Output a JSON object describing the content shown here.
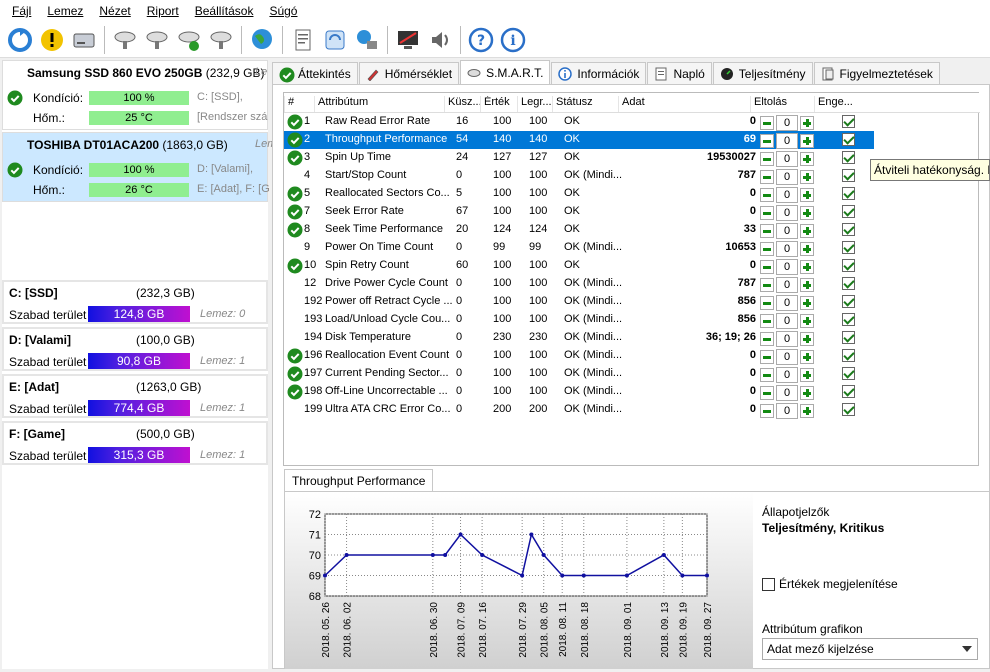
{
  "menu": [
    "Fájl",
    "Lemez",
    "Nézet",
    "Riport",
    "Beállítások",
    "Súgó"
  ],
  "drives": [
    {
      "name": "Samsung SSD 860 EVO 250GB",
      "size": "(232,9 GB)",
      "lemez": "Le",
      "cond_label": "Kondíció:",
      "cond": "100 %",
      "cond_aux": "C: [SSD],",
      "temp_label": "Hőm.:",
      "temp": "25 °C",
      "temp_aux": "[Rendszer szá"
    },
    {
      "name": "TOSHIBA DT01ACA200",
      "size": "(1863,0 GB)",
      "lemez": "Lemez: 1",
      "cond_label": "Kondíció:",
      "cond": "100 %",
      "cond_aux": "D: [Valami],",
      "temp_label": "Hőm.:",
      "temp": "26 °C",
      "temp_aux": "E: [Adat], F: [G"
    }
  ],
  "volumes": [
    {
      "name": "C: [SSD]",
      "size": "(232,3 GB)",
      "free_label": "Szabad terület",
      "free": "124,8 GB",
      "lemez": "Lemez: 0"
    },
    {
      "name": "D: [Valami]",
      "size": "(100,0 GB)",
      "free_label": "Szabad terület",
      "free": "90,8 GB",
      "lemez": "Lemez: 1"
    },
    {
      "name": "E: [Adat]",
      "size": "(1263,0 GB)",
      "free_label": "Szabad terület",
      "free": "774,4 GB",
      "lemez": "Lemez: 1"
    },
    {
      "name": "F: [Game]",
      "size": "(500,0 GB)",
      "free_label": "Szabad terület",
      "free": "315,3 GB",
      "lemez": "Lemez: 1"
    }
  ],
  "tabs": [
    "Áttekintés",
    "Hőmérséklet",
    "S.M.A.R.T.",
    "Információk",
    "Napló",
    "Teljesítmény",
    "Figyelmeztetések"
  ],
  "columns": [
    "#",
    "Attribútum",
    "Küsz...",
    "Érték",
    "Legr...",
    "Státusz",
    "Adat",
    "Eltolás",
    "Enge..."
  ],
  "rows": [
    {
      "id": "1",
      "attr": "Raw Read Error Rate",
      "thr": "16",
      "val": "100",
      "worst": "100",
      "status": "OK",
      "data": "0",
      "shift": "0",
      "ok": true
    },
    {
      "id": "2",
      "attr": "Throughput Performance",
      "thr": "54",
      "val": "140",
      "worst": "140",
      "status": "OK",
      "data": "69",
      "shift": "0",
      "ok": true,
      "sel": true
    },
    {
      "id": "3",
      "attr": "Spin Up Time",
      "thr": "24",
      "val": "127",
      "worst": "127",
      "status": "OK",
      "data": "19530027",
      "shift": "0",
      "ok": true
    },
    {
      "id": "4",
      "attr": "Start/Stop Count",
      "thr": "0",
      "val": "100",
      "worst": "100",
      "status": "OK (Mindi...",
      "data": "787",
      "shift": "0",
      "ok": false
    },
    {
      "id": "5",
      "attr": "Reallocated Sectors Co...",
      "thr": "5",
      "val": "100",
      "worst": "100",
      "status": "OK",
      "data": "0",
      "shift": "0",
      "ok": true
    },
    {
      "id": "7",
      "attr": "Seek Error Rate",
      "thr": "67",
      "val": "100",
      "worst": "100",
      "status": "OK",
      "data": "0",
      "shift": "0",
      "ok": true
    },
    {
      "id": "8",
      "attr": "Seek Time Performance",
      "thr": "20",
      "val": "124",
      "worst": "124",
      "status": "OK",
      "data": "33",
      "shift": "0",
      "ok": true
    },
    {
      "id": "9",
      "attr": "Power On Time Count",
      "thr": "0",
      "val": "99",
      "worst": "99",
      "status": "OK (Mindi...",
      "data": "10653",
      "shift": "0",
      "ok": false
    },
    {
      "id": "10",
      "attr": "Spin Retry Count",
      "thr": "60",
      "val": "100",
      "worst": "100",
      "status": "OK",
      "data": "0",
      "shift": "0",
      "ok": true
    },
    {
      "id": "12",
      "attr": "Drive Power Cycle Count",
      "thr": "0",
      "val": "100",
      "worst": "100",
      "status": "OK (Mindi...",
      "data": "787",
      "shift": "0",
      "ok": false
    },
    {
      "id": "192",
      "attr": "Power off Retract Cycle ...",
      "thr": "0",
      "val": "100",
      "worst": "100",
      "status": "OK (Mindi...",
      "data": "856",
      "shift": "0",
      "ok": false
    },
    {
      "id": "193",
      "attr": "Load/Unload Cycle Cou...",
      "thr": "0",
      "val": "100",
      "worst": "100",
      "status": "OK (Mindi...",
      "data": "856",
      "shift": "0",
      "ok": false
    },
    {
      "id": "194",
      "attr": "Disk Temperature",
      "thr": "0",
      "val": "230",
      "worst": "230",
      "status": "OK (Mindi...",
      "data": "36; 19; 26",
      "shift": "0",
      "ok": false
    },
    {
      "id": "196",
      "attr": "Reallocation Event Count",
      "thr": "0",
      "val": "100",
      "worst": "100",
      "status": "OK (Mindi...",
      "data": "0",
      "shift": "0",
      "ok": true
    },
    {
      "id": "197",
      "attr": "Current Pending Sector...",
      "thr": "0",
      "val": "100",
      "worst": "100",
      "status": "OK (Mindi...",
      "data": "0",
      "shift": "0",
      "ok": true
    },
    {
      "id": "198",
      "attr": "Off-Line Uncorrectable ...",
      "thr": "0",
      "val": "100",
      "worst": "100",
      "status": "OK (Mindi...",
      "data": "0",
      "shift": "0",
      "ok": true
    },
    {
      "id": "199",
      "attr": "Ultra ATA CRC Error Co...",
      "thr": "0",
      "val": "200",
      "worst": "200",
      "status": "OK (Mindi...",
      "data": "0",
      "shift": "0",
      "ok": false
    }
  ],
  "tooltip": "Átviteli hatékonyság. M",
  "bottom": {
    "tab": "Throughput Performance",
    "status_label": "Állapotjelzők",
    "status_value": "Teljesítmény, Kritikus",
    "show_values": "Értékek megjelenítése",
    "attr_graph_label": "Attribútum grafikon",
    "attr_graph_value": "Adat mező kijelzése"
  },
  "chart_data": {
    "type": "line",
    "title": "",
    "xlabel": "",
    "ylabel": "",
    "ylim": [
      68,
      72
    ],
    "yticks": [
      68,
      69,
      70,
      71,
      72
    ],
    "x": [
      "2018. 05. 26",
      "2018. 06. 02",
      "2018. 06. 30",
      "2018. 07. 09",
      "2018. 07. 16",
      "2018. 07. 29",
      "2018. 08. 05",
      "2018. 08. 11",
      "2018. 08. 18",
      "2018. 09. 01",
      "2018. 09. 13",
      "2018. 09. 19",
      "2018. 09. 27"
    ],
    "points": [
      {
        "x": "2018. 05. 26",
        "y": 69
      },
      {
        "x": "2018. 06. 02",
        "y": 70
      },
      {
        "x": "2018. 06. 30",
        "y": 70
      },
      {
        "x": "2018. 07. 04",
        "y": 70
      },
      {
        "x": "2018. 07. 09",
        "y": 71
      },
      {
        "x": "2018. 07. 16",
        "y": 70
      },
      {
        "x": "2018. 07. 29",
        "y": 69
      },
      {
        "x": "2018. 08. 01",
        "y": 71
      },
      {
        "x": "2018. 08. 05",
        "y": 70
      },
      {
        "x": "2018. 08. 11",
        "y": 69
      },
      {
        "x": "2018. 08. 18",
        "y": 69
      },
      {
        "x": "2018. 09. 01",
        "y": 69
      },
      {
        "x": "2018. 09. 13",
        "y": 70
      },
      {
        "x": "2018. 09. 19",
        "y": 69
      },
      {
        "x": "2018. 09. 27",
        "y": 69
      }
    ],
    "grid": true,
    "color": "#1010a0"
  }
}
